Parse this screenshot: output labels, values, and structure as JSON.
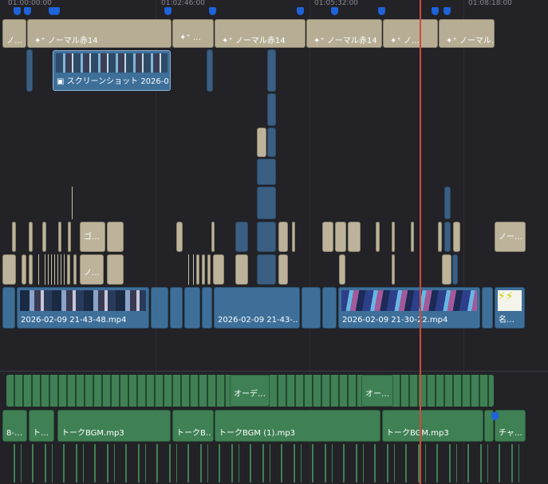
{
  "ruler": {
    "timecodes": [
      "01:00:00:00",
      "01:02:46:00",
      "01:05:32:00",
      "01:08:18:00"
    ]
  },
  "title_clips": {
    "short": "ノ…",
    "normal": "ノーマル赤14",
    "normal_cut": "ノーマル…",
    "normal_cut2": "ノ…",
    "sparkle_icon": "sparkle-icon"
  },
  "image_clip": {
    "label": "スクリーンショット 2026-0…",
    "icon": "image-icon"
  },
  "text_clips": {
    "go": "ゴ…",
    "no": "ノ…",
    "no_right": "ノー…"
  },
  "video_clips": {
    "clip1": "2026-02-09 21-43-48.mp4",
    "clip2": "2026-02-09 21-43-…",
    "clip3": "2026-02-09 21-30-22.mp4",
    "clip4": "名…"
  },
  "audio_clips": {
    "ode1": "オーデ…",
    "ode2": "オー…",
    "a1": "8-…",
    "a2": "ト…",
    "bgm1": "トークBGM.mp3",
    "bgm2": "トークB…",
    "bgm3": "トークBGM (1).mp3",
    "bgm4": "トークBGM.mp3",
    "cha": "チャ…"
  },
  "colors": {
    "playhead": "#d04a3c",
    "marker": "#1e63d8",
    "video": "#3d6f99",
    "audio": "#3f8054",
    "title": "#b7ad94"
  }
}
